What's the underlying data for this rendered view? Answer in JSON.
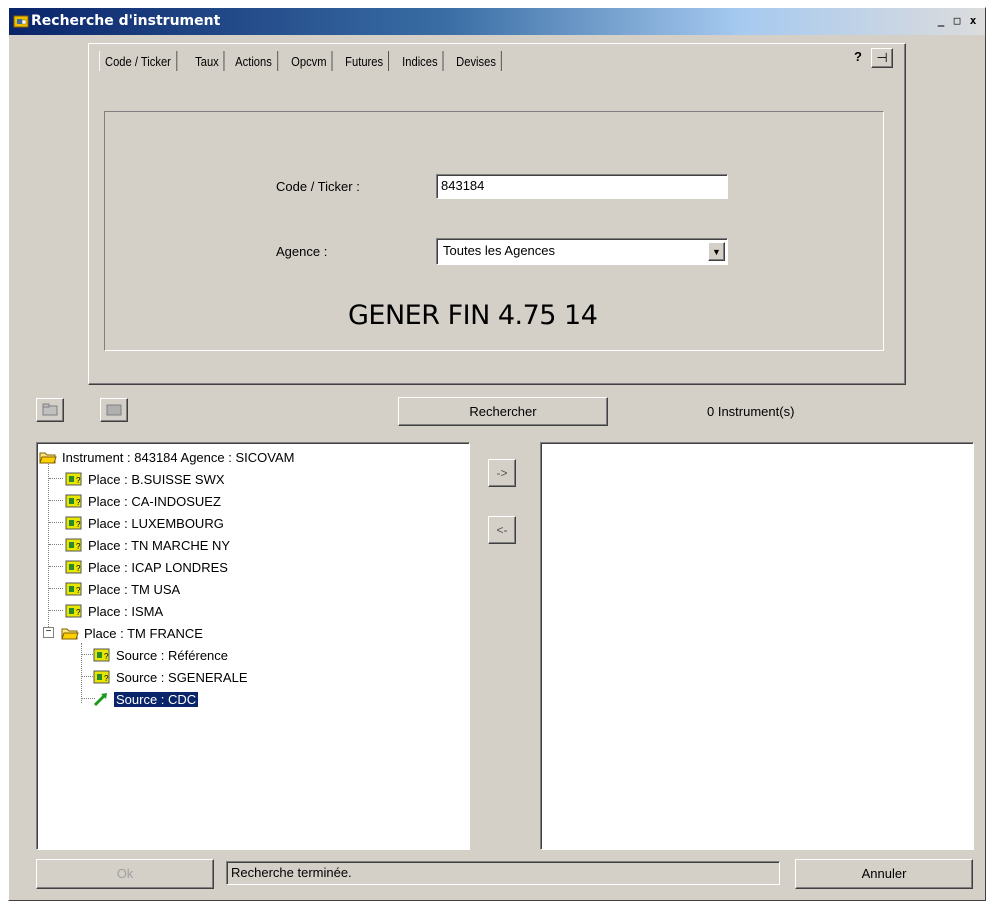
{
  "window": {
    "title": "Recherche d'instrument",
    "controls": [
      "_",
      "□",
      "x"
    ]
  },
  "tabs": [
    "Code / Ticker",
    "Taux",
    "Actions",
    "Opcvm",
    "Futures",
    "Indices",
    "Devises"
  ],
  "header_buttons": {
    "help": "?",
    "pin": "⊣"
  },
  "search": {
    "code_label": "Code / Ticker :",
    "code_value": "843184",
    "agence_label": "Agence :",
    "agence_value": "Toutes les Agences"
  },
  "instrument_name": "GENER FIN 4.75 14",
  "toolbar": {
    "rechercher_label": "Rechercher",
    "count_text": "0 Instrument(s)"
  },
  "tree": {
    "root": "Instrument : 843184 Agence : SICOVAM",
    "places": [
      "Place : B.SUISSE SWX",
      "Place : CA-INDOSUEZ",
      "Place : LUXEMBOURG",
      "Place : TN MARCHE NY",
      "Place : ICAP LONDRES",
      "Place : TM USA",
      "Place : ISMA",
      "Place : TM FRANCE"
    ],
    "sources": [
      "Source : Référence",
      "Source : SGENERALE",
      "Source : CDC"
    ],
    "expander": "−"
  },
  "arrows": {
    "add": "->",
    "remove": "<-"
  },
  "footer": {
    "ok_label": "Ok",
    "status_text": "Recherche terminée.",
    "annuler_label": "Annuler"
  },
  "colors": {
    "title_bar": "#0a246a",
    "selection": "#0a246a",
    "face": "#d4d0c8"
  }
}
